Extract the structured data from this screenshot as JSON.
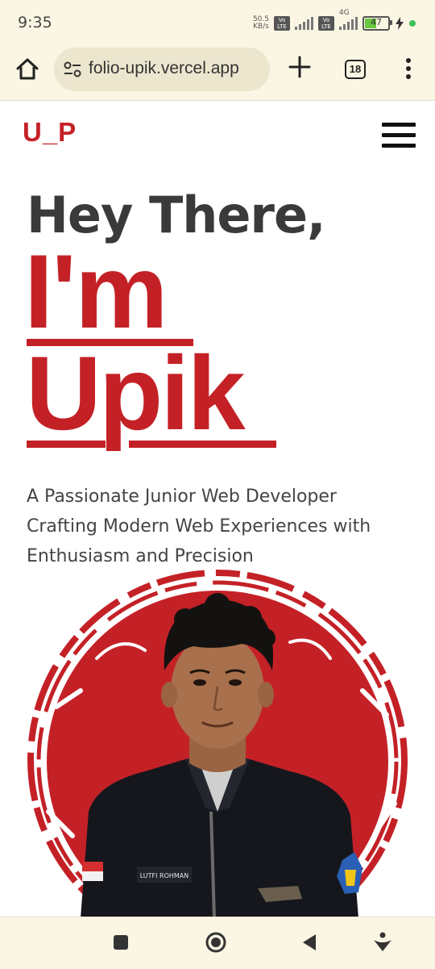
{
  "status_bar": {
    "time": "9:35",
    "net_speed_value": "50.5",
    "net_speed_unit": "KB/s",
    "volte1": "Vo LTE",
    "volte2": "Vo LTE",
    "network": "4G",
    "battery": "47"
  },
  "browser": {
    "url": "folio-upik.vercel.app",
    "tab_count": "18"
  },
  "site": {
    "logo": "U_P",
    "greeting": "Hey There,",
    "intro": "I'm",
    "name": "Upik",
    "tagline": "A Passionate Junior Web Developer Crafting Modern Web Experiences with Enthusiasm and Precision",
    "accent_color": "#c42127"
  },
  "portrait": {
    "badge_text": "LUTFI ROHMAN"
  },
  "icons": {
    "home": "home-icon",
    "site_settings": "tune-icon",
    "new_tab": "plus-icon",
    "tabs": "tab-switcher-icon",
    "overflow": "more-vert-icon",
    "hamburger": "menu-icon",
    "nav_recents": "square-icon",
    "nav_home": "circle-icon",
    "nav_back": "triangle-back-icon",
    "nav_assistant": "assistant-icon"
  }
}
